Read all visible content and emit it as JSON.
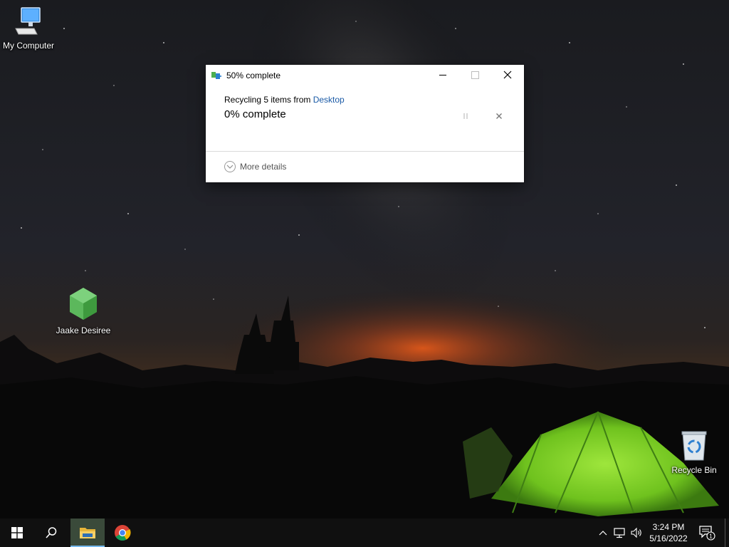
{
  "desktop": {
    "icons": [
      {
        "label": "My Computer",
        "icon": "computer-icon"
      },
      {
        "label": "Jaake Desiree",
        "icon": "green-hexagon-app-icon"
      },
      {
        "label": "Recycle Bin",
        "icon": "recycle-bin-icon"
      }
    ]
  },
  "dialog": {
    "title": "50% complete",
    "line1_prefix": "Recycling 5 items from ",
    "line1_link": "Desktop",
    "progress_text": "0% complete",
    "more_details": "More details",
    "progress_percent": 0
  },
  "taskbar": {
    "pinned": [
      "start-icon",
      "search-icon",
      "file-explorer-icon",
      "chrome-icon"
    ],
    "clock": {
      "time": "3:24 PM",
      "date": "5/16/2022"
    },
    "notification_count": "1"
  },
  "colors": {
    "link": "#1a5aa6",
    "taskbar": "#101010",
    "active_task_underline": "#76b9ed"
  }
}
